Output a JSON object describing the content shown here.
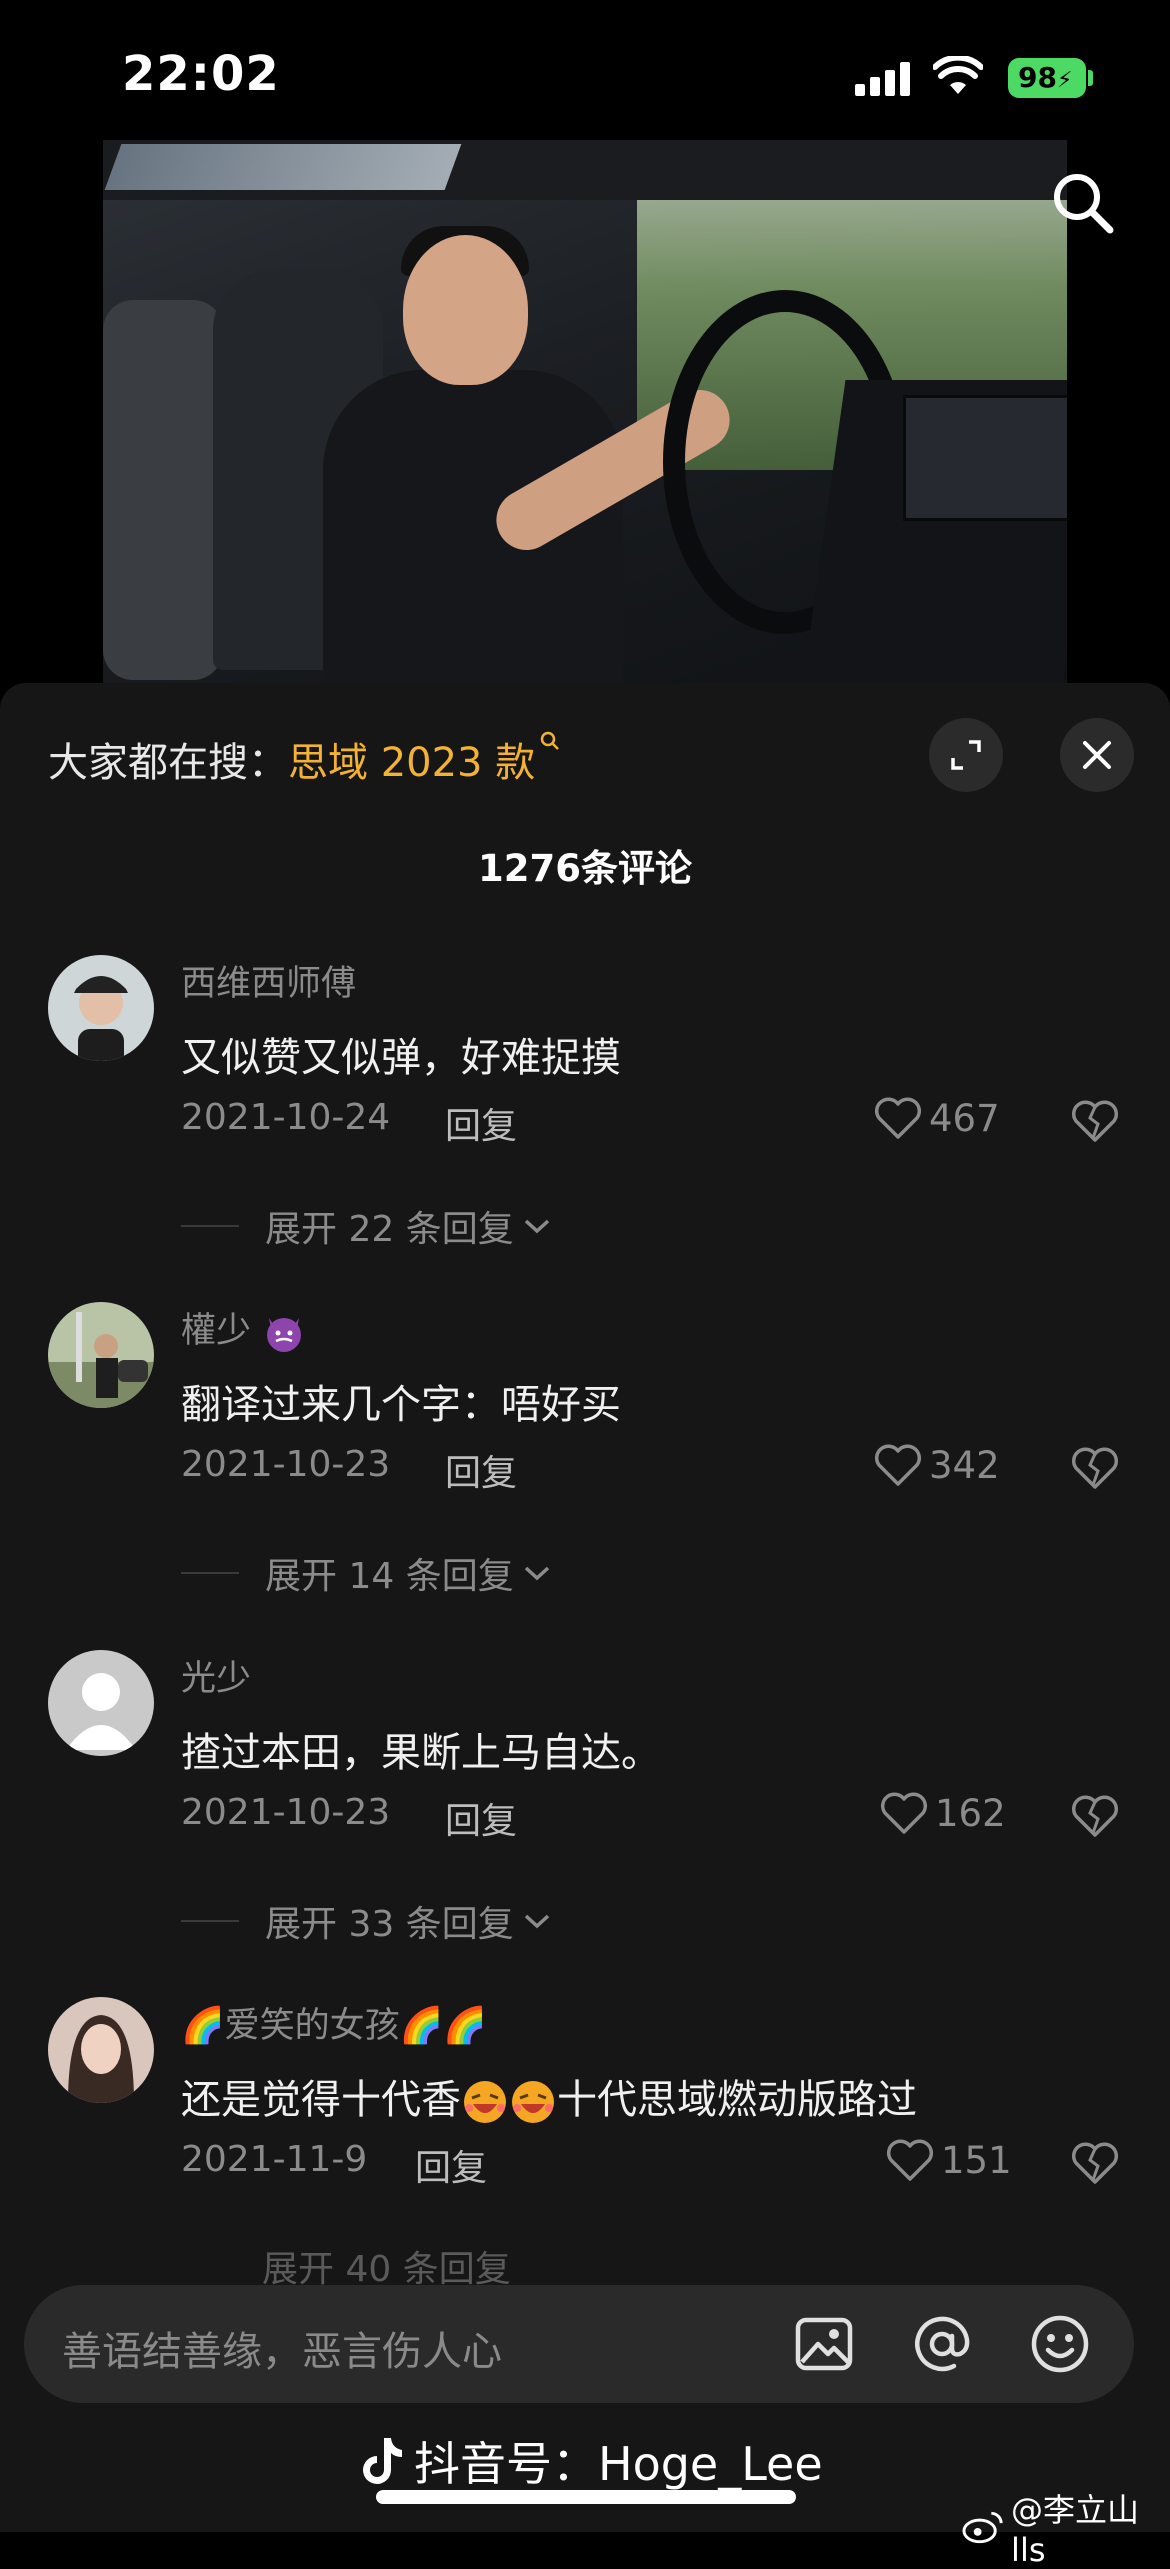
{
  "status": {
    "time": "22:02",
    "battery": "98"
  },
  "search_bar": {
    "label": "大家都在搜：",
    "keyword": "思域 2023 款"
  },
  "comments_header": {
    "count_title": "1276条评论"
  },
  "comments": [
    {
      "user": "西维西师傅",
      "text": "又似赞又似弹，好难捉摸",
      "date": "2021-10-24",
      "reply": "回复",
      "likes": "467",
      "expand": "展开 22 条回复"
    },
    {
      "user": "權少",
      "text": "翻译过来几个字：唔好买",
      "date": "2021-10-23",
      "reply": "回复",
      "likes": "342",
      "expand": "展开 14 条回复"
    },
    {
      "user": "光少",
      "text": "揸过本田，果断上马自达。",
      "date": "2021-10-23",
      "reply": "回复",
      "likes": "162",
      "expand": "展开 33 条回复"
    },
    {
      "user": "爱笑的女孩",
      "text_before": "还是觉得十代香",
      "text_after": "十代思域燃动版路过",
      "date": "2021-11-9",
      "reply": "回复",
      "likes": "151",
      "expand": "展开 40 条回复"
    }
  ],
  "input": {
    "placeholder": "善语结善缘，恶言伤人心"
  },
  "footer": {
    "douyin_id": "抖音号：Hoge_Lee",
    "weibo": "@李立山lls"
  },
  "colors": {
    "accent_keyword": "#f2b233",
    "sheet_bg": "#161616"
  }
}
